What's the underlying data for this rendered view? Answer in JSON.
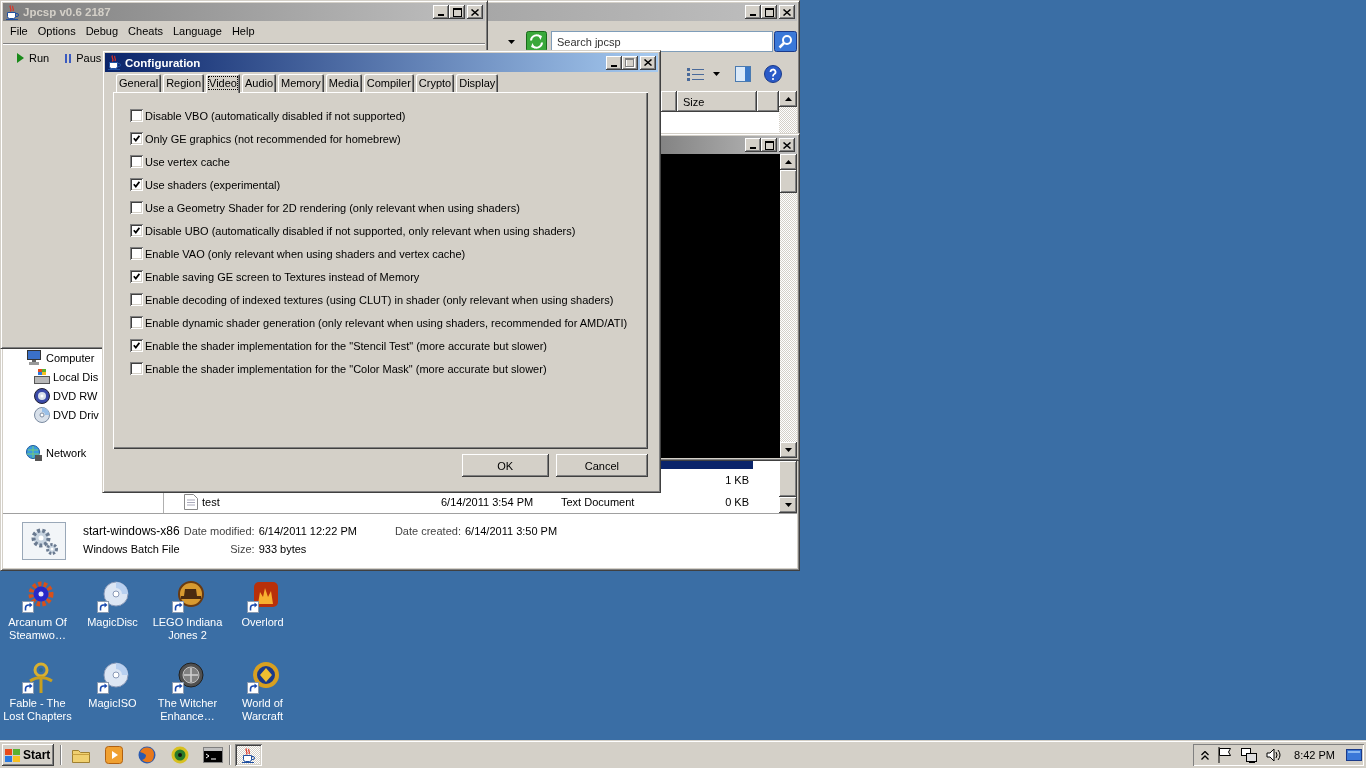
{
  "jpcsp": {
    "title": "Jpcsp v0.6 2187",
    "active": false,
    "menu": [
      "File",
      "Options",
      "Debug",
      "Cheats",
      "Language",
      "Help"
    ],
    "toolbar": [
      {
        "label": "Run",
        "kind": "run"
      },
      {
        "label": "Paus",
        "kind": "pause"
      }
    ]
  },
  "explorer": {
    "active": false,
    "search": {
      "placeholder": "Search jpcsp"
    },
    "columns": [
      {
        "label": "Size"
      }
    ],
    "nav": [
      {
        "label": "Computer",
        "kind": "computer",
        "children": [
          {
            "label": "Local Dis",
            "kind": "drive"
          },
          {
            "label": "DVD RW",
            "kind": "dvdrw"
          },
          {
            "label": "DVD Driv",
            "kind": "dvd"
          }
        ]
      },
      {
        "label": "Network",
        "kind": "network"
      }
    ],
    "rows": [
      {
        "selected": true
      },
      {
        "size": "1 KB",
        "selected": false
      },
      {
        "name": "test",
        "date_modified": "6/14/2011 3:54 PM",
        "type": "Text Document",
        "size": "0 KB",
        "selected": false
      }
    ],
    "details": {
      "name": "start-windows-x86",
      "type": "Windows Batch File",
      "fields": [
        {
          "label": "Date modified:",
          "value": "6/14/2011 12:22 PM"
        },
        {
          "label": "Date created:",
          "value": "6/14/2011 3:50 PM"
        },
        {
          "label": "Size:",
          "value": "933 bytes"
        }
      ]
    }
  },
  "console": {
    "active": false
  },
  "config_dialog": {
    "title": "Configuration",
    "active": true,
    "maximize_disabled": true,
    "tabs": [
      {
        "label": "General",
        "selected": false
      },
      {
        "label": "Region",
        "selected": false
      },
      {
        "label": "Video",
        "selected": true
      },
      {
        "label": "Audio",
        "selected": false
      },
      {
        "label": "Memory",
        "selected": false
      },
      {
        "label": "Media",
        "selected": false
      },
      {
        "label": "Compiler",
        "selected": false
      },
      {
        "label": "Crypto",
        "selected": false
      },
      {
        "label": "Display",
        "selected": false
      }
    ],
    "options": [
      {
        "label": "Disable VBO (automatically disabled if not supported)",
        "checked": false
      },
      {
        "label": "Only GE graphics (not recommended for homebrew)",
        "checked": true
      },
      {
        "label": "Use vertex cache",
        "checked": false
      },
      {
        "label": "Use shaders (experimental)",
        "checked": true
      },
      {
        "label": "Use a Geometry Shader for 2D rendering (only relevant when using shaders)",
        "checked": false
      },
      {
        "label": "Disable UBO (automatically disabled if not supported, only relevant when using shaders)",
        "checked": true
      },
      {
        "label": "Enable VAO (only relevant when using shaders and vertex cache)",
        "checked": false
      },
      {
        "label": "Enable saving GE screen to Textures instead of Memory",
        "checked": true
      },
      {
        "label": "Enable decoding of indexed textures (using CLUT) in shader (only relevant when using shaders)",
        "checked": false
      },
      {
        "label": "Enable dynamic shader generation (only relevant when using shaders, recommended for AMD/ATI)",
        "checked": false
      },
      {
        "label": "Enable the shader implementation for the \"Stencil Test\" (more accurate but slower)",
        "checked": true
      },
      {
        "label": "Enable the shader implementation for the \"Color Mask\" (more accurate but slower)",
        "checked": false
      }
    ],
    "buttons": [
      "OK",
      "Cancel"
    ]
  },
  "desktop_icons": [
    {
      "label": "Arcanum Of Steamwo…",
      "kind": "gear"
    },
    {
      "label": "MagicDisc",
      "kind": "disc"
    },
    {
      "label": "LEGO Indiana Jones 2",
      "kind": "hat"
    },
    {
      "label": "Overlord",
      "kind": "flame"
    },
    {
      "label": "Fable - The Lost Chapters",
      "kind": "emblem"
    },
    {
      "label": "MagicISO",
      "kind": "disc"
    },
    {
      "label": "The Witcher Enhance…",
      "kind": "medallion"
    },
    {
      "label": "World of Warcraft",
      "kind": "ring"
    }
  ],
  "taskbar": {
    "start": "Start",
    "tasks": [
      {
        "selected": true
      }
    ],
    "clock": "8:42 PM"
  }
}
